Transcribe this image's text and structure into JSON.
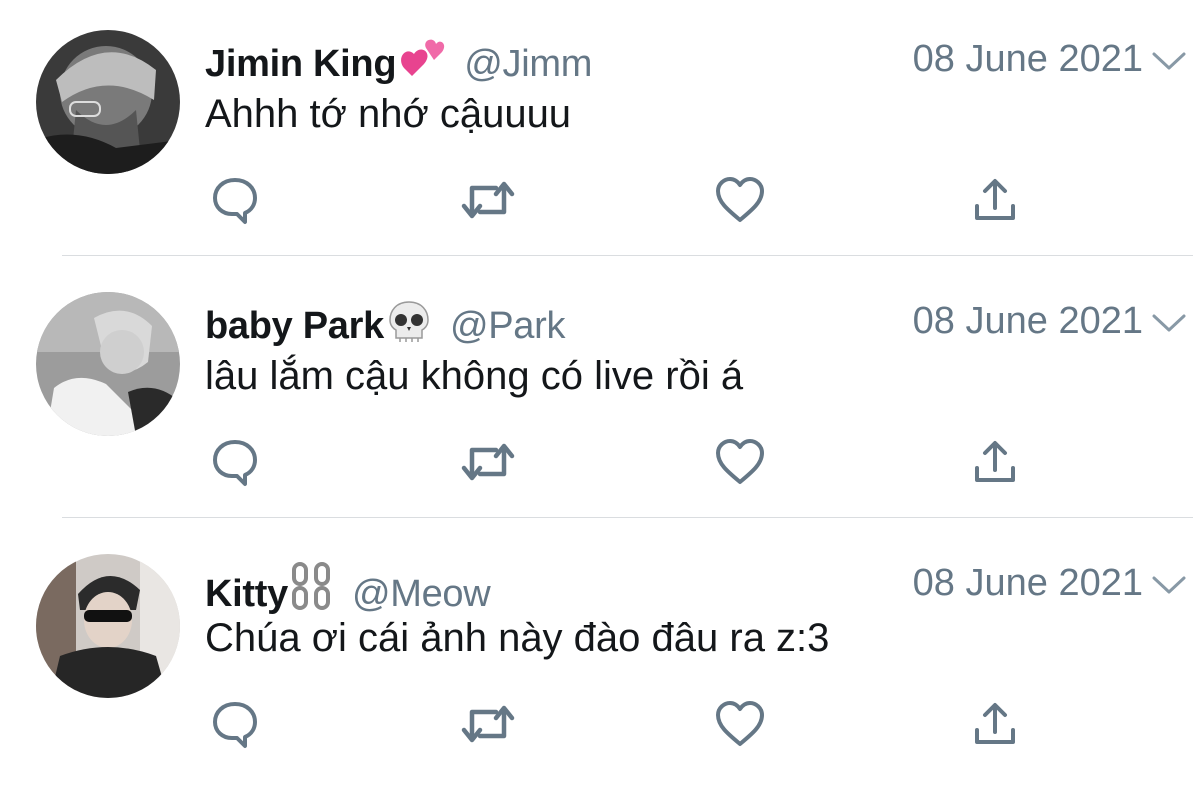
{
  "tweets": [
    {
      "name": "Jimin King",
      "name_emoji": "two-hearts-icon",
      "handle": "@Jimm",
      "date": "08 June 2021",
      "text": "Ahhh tớ nhớ cậuuuu"
    },
    {
      "name": "baby Park",
      "name_emoji": "skull-icon",
      "handle": "@Park",
      "date": "08 June 2021",
      "text": "lâu lắm cậu không có live rồi á"
    },
    {
      "name": "Kitty",
      "name_emoji": "chains-icon",
      "handle": "@Meow",
      "date": "08 June 2021",
      "text": "Chúa ơi cái ảnh này đào đâu ra z:3"
    }
  ],
  "icons": {
    "reply": "reply-icon",
    "retweet": "retweet-icon",
    "like": "heart-icon",
    "share": "share-icon",
    "more": "chevron-down-icon"
  },
  "colors": {
    "text": "#14171a",
    "secondary": "#657786",
    "icon": "#657786",
    "divider": "#dadde0",
    "heart_emoji": "#e8438f"
  }
}
